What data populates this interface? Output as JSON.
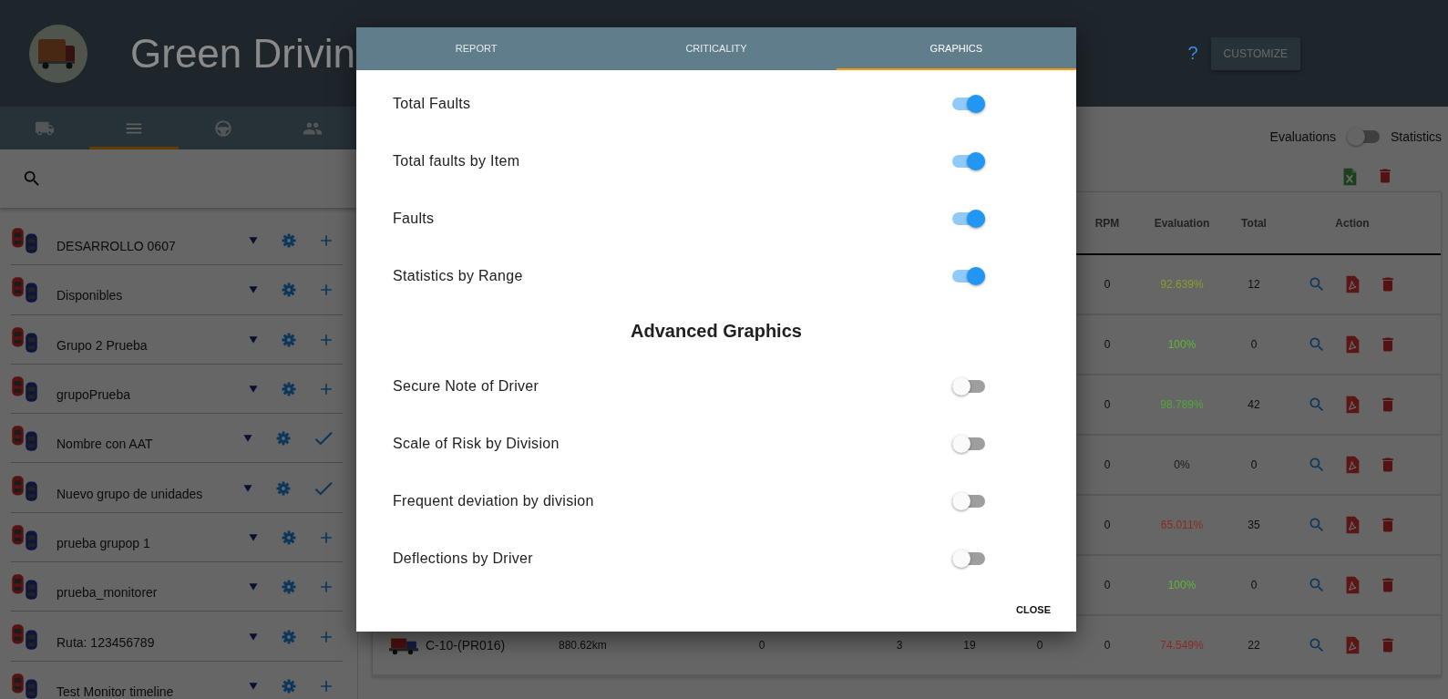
{
  "header": {
    "title": "Green Drivin",
    "help": "?",
    "customize_button": "CUSTOMIZE"
  },
  "nav_tabs": [
    {
      "kind": "truck",
      "selected": false
    },
    {
      "kind": "list",
      "selected": true
    },
    {
      "kind": "steering",
      "selected": false
    },
    {
      "kind": "people",
      "selected": false
    }
  ],
  "sidebar": {
    "groups": [
      {
        "name": "DESARROLLO 0607",
        "checked": false
      },
      {
        "name": "Disponibles",
        "checked": false
      },
      {
        "name": "Grupo 2 Prueba",
        "checked": false
      },
      {
        "name": "grupoPrueba",
        "checked": false
      },
      {
        "name": "Nombre con AAT",
        "checked": true
      },
      {
        "name": "Nuevo grupo de unidades",
        "checked": true
      },
      {
        "name": "prueba grupop 1",
        "checked": false
      },
      {
        "name": "prueba_monitorer",
        "checked": false
      },
      {
        "name": "Ruta: 123456789",
        "checked": false
      },
      {
        "name": "Test Monitor timeline",
        "checked": false
      }
    ]
  },
  "view_switch": {
    "left_label": "Evaluations",
    "right_label": "Statistics",
    "on": false
  },
  "table": {
    "columns": [
      "RPM",
      "Evaluation",
      "Total",
      "Action"
    ],
    "rows": [
      {
        "rpm": "0",
        "evaluation": "92.639%",
        "color": "#8c9c2c",
        "total": "12"
      },
      {
        "rpm": "0",
        "evaluation": "100%",
        "color": "#5cb83a",
        "total": "0"
      },
      {
        "rpm": "0",
        "evaluation": "98.789%",
        "color": "#52a836",
        "total": "42"
      },
      {
        "rpm": "0",
        "evaluation": "0%",
        "color": "#1a1a1a",
        "total": "0"
      },
      {
        "rpm": "0",
        "evaluation": "65.011%",
        "color": "#8c2a22",
        "total": "35"
      },
      {
        "rpm": "0",
        "evaluation": "100%",
        "color": "#5cb83a",
        "total": "0"
      },
      {
        "vehicle": "C-10-(PR016)",
        "distance": "880.62km",
        "column_3": "0",
        "column_4": "3",
        "column_5": "19",
        "column_6": "0",
        "rpm": "0",
        "evaluation": "74.549%",
        "color": "#8c2a22",
        "total": "22"
      }
    ]
  },
  "dialog": {
    "tabs": [
      {
        "label": "REPORT",
        "selected": false
      },
      {
        "label": "CRITICALITY",
        "selected": false
      },
      {
        "label": "GRAPHICS",
        "selected": true
      }
    ],
    "toggles": [
      {
        "label": "Total Faults",
        "on": true
      },
      {
        "label": "Total faults by Item",
        "on": true
      },
      {
        "label": "Faults",
        "on": true
      },
      {
        "label": "Statistics by Range",
        "on": true
      }
    ],
    "advanced_heading": "Advanced Graphics",
    "advanced_toggles": [
      {
        "label": "Secure Note of Driver",
        "on": false
      },
      {
        "label": "Scale of Risk by Division",
        "on": false
      },
      {
        "label": "Frequent deviation by division",
        "on": false
      },
      {
        "label": "Deflections by Driver",
        "on": false
      }
    ],
    "close_button": "CLOSE"
  }
}
